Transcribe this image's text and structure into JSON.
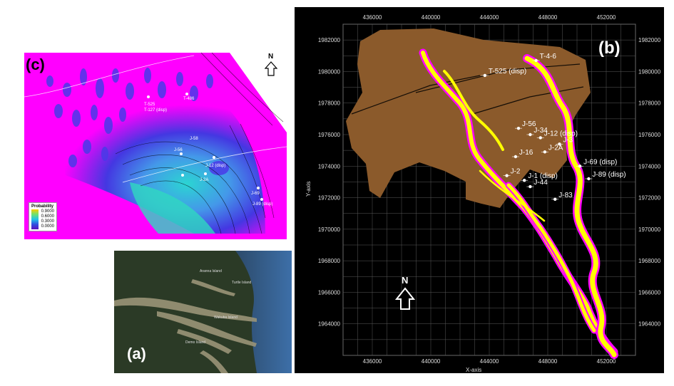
{
  "panels": {
    "b": {
      "label": "(b)",
      "x_axis_title": "X-axis",
      "y_axis_title": "Y-axis",
      "x_ticks": [
        "436000",
        "440000",
        "444000",
        "448000",
        "452000"
      ],
      "y_ticks": [
        "1982000",
        "1980000",
        "1978000",
        "1976000",
        "1974000",
        "1972000",
        "1970000",
        "1968000",
        "1966000",
        "1964000"
      ],
      "north_label": "N",
      "wells": [
        {
          "name": "T-525 (disp)",
          "x": 443700,
          "y": 1979750
        },
        {
          "name": "T-4-6",
          "x": 447200,
          "y": 1980700
        },
        {
          "name": "J-56",
          "x": 446000,
          "y": 1976400
        },
        {
          "name": "J-34",
          "x": 446800,
          "y": 1976000
        },
        {
          "name": "J-12 (disp)",
          "x": 447500,
          "y": 1975800
        },
        {
          "name": "J-3",
          "x": 448800,
          "y": 1975400
        },
        {
          "name": "J-2A",
          "x": 447800,
          "y": 1974900
        },
        {
          "name": "J-16",
          "x": 445800,
          "y": 1974600
        },
        {
          "name": "J-69 (disp)",
          "x": 450200,
          "y": 1974000
        },
        {
          "name": "J-89 (disp)",
          "x": 450800,
          "y": 1973200
        },
        {
          "name": "J-2",
          "x": 445200,
          "y": 1973400
        },
        {
          "name": "J-1 (disp)",
          "x": 446400,
          "y": 1973100
        },
        {
          "name": "J-44",
          "x": 446800,
          "y": 1972700
        },
        {
          "name": "J-83",
          "x": 448500,
          "y": 1971900
        }
      ],
      "colors": {
        "background": "#000000",
        "mud": "#8b5a2b",
        "sand": "#ffff00",
        "edge": "#ff00ff",
        "grid": "#5a5a5a"
      }
    },
    "c": {
      "label": "(c)",
      "north_label": "N",
      "legend_title": "Probability",
      "legend_values": [
        "0.9000",
        "0.6000",
        "0.3000",
        "0.0000"
      ],
      "wells": [
        "T-525",
        "T-127 (disp)",
        "T-486",
        "J-56",
        "J-58",
        "J-12 (disp)",
        "J-2A",
        "J-69",
        "J-89 (disp)"
      ],
      "colors": {
        "background": "#ff00ff",
        "high": "#ffcc00",
        "mid": "#22c4e8",
        "low": "#3050e0"
      }
    },
    "a": {
      "label": "(a)",
      "place_names": [
        "Aranna Island",
        "Turtle Island",
        "Wakuba Island",
        "Demo Island"
      ]
    }
  }
}
